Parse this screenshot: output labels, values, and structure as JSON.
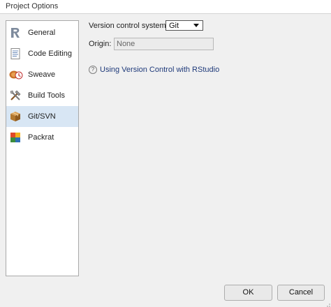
{
  "window": {
    "title": "Project Options"
  },
  "sidebar": {
    "items": [
      {
        "label": "General",
        "icon": "r-logo-icon",
        "selected": false
      },
      {
        "label": "Code Editing",
        "icon": "document-icon",
        "selected": false
      },
      {
        "label": "Sweave",
        "icon": "sweave-icon",
        "selected": false
      },
      {
        "label": "Build Tools",
        "icon": "tools-icon",
        "selected": false
      },
      {
        "label": "Git/SVN",
        "icon": "box-icon",
        "selected": true
      },
      {
        "label": "Packrat",
        "icon": "packrat-icon",
        "selected": false
      }
    ],
    "selected_color": "#d8e6f4"
  },
  "main": {
    "vcs_label": "Version control system:",
    "vcs_value": "Git",
    "origin_label": "Origin:",
    "origin_value": "None",
    "help_icon": "?",
    "help_link": "Using Version Control with RStudio",
    "link_color": "#1f3a7a"
  },
  "footer": {
    "ok_label": "OK",
    "cancel_label": "Cancel"
  }
}
